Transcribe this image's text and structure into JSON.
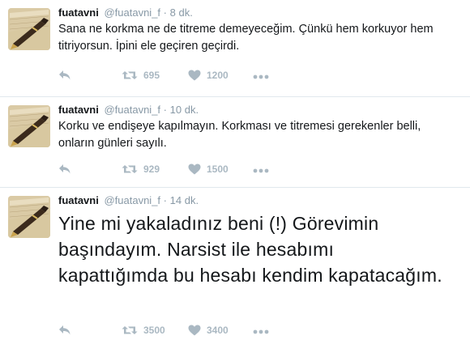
{
  "tweets": [
    {
      "fullname": "fuatavni",
      "username": "@fuatavni_f",
      "separator": "·",
      "time": "8 dk.",
      "text": "Sana ne korkma ne de titreme demeyeceğim. Çünkü hem korkuyor hem titriyorsun. İpini ele geçiren geçirdi.",
      "retweets": "695",
      "likes": "1200"
    },
    {
      "fullname": "fuatavni",
      "username": "@fuatavni_f",
      "separator": "·",
      "time": "10 dk.",
      "text": "Korku ve endişeye kapılmayın. Korkması ve titremesi gerekenler belli, onların günleri sayılı.",
      "retweets": "929",
      "likes": "1500"
    },
    {
      "fullname": "fuatavni",
      "username": "@fuatavni_f",
      "separator": "·",
      "time": "14 dk.",
      "text": "Yine mi yakaladınız beni (!) Görevimin başındayım. Narsist ile hesabımı kapattığımda bu hesabı kendim kapatacağım.",
      "retweets": "3500",
      "likes": "3400"
    }
  ],
  "icons": {
    "reply": "reply-icon",
    "retweet": "retweet-icon",
    "like": "heart-icon",
    "more": "more-icon",
    "avatar": "pen-on-paper-avatar"
  },
  "colors": {
    "name": "#14171a",
    "meta": "#8899a6",
    "action": "#aab8c2",
    "divider": "#e1e8ed"
  }
}
